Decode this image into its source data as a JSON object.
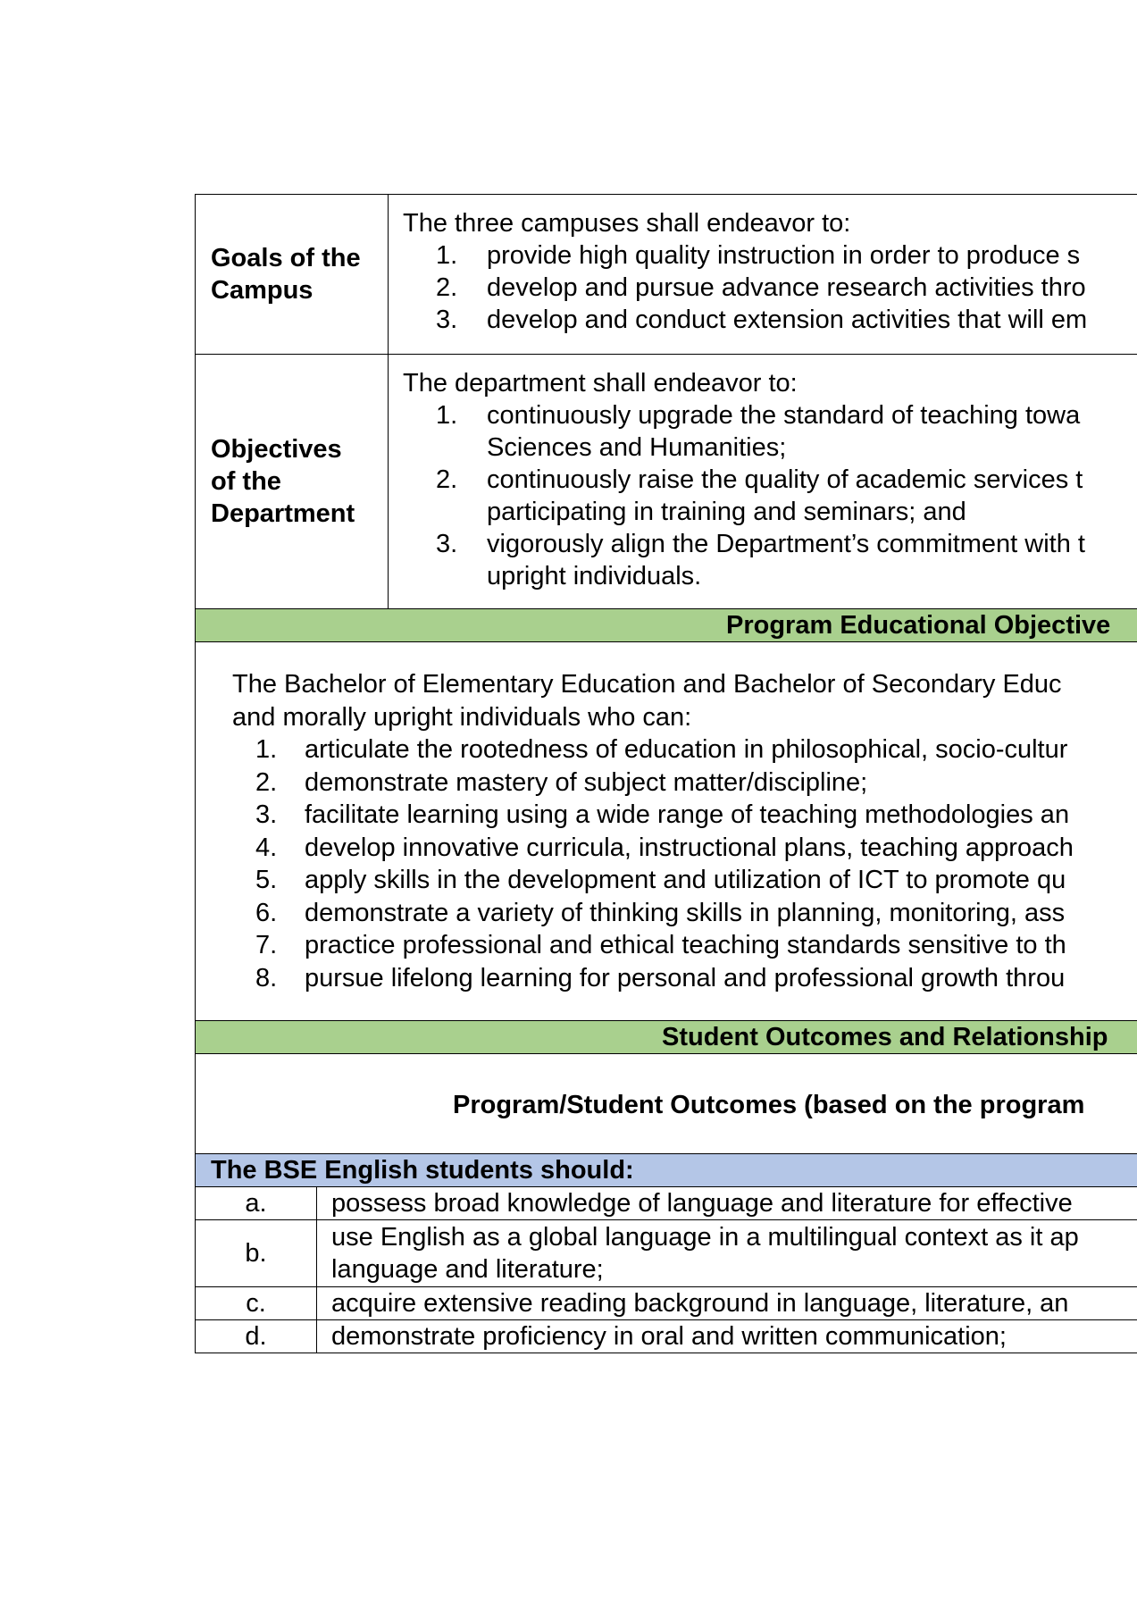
{
  "goals": {
    "label": "Goals of the Campus",
    "intro": "The three campuses shall endeavor to:",
    "items": [
      {
        "n": "1.",
        "text": "provide high quality instruction in order to produce s"
      },
      {
        "n": "2.",
        "text": "develop and pursue advance research activities thro"
      },
      {
        "n": "3.",
        "text": "develop and conduct extension activities that will em"
      }
    ]
  },
  "objectives": {
    "label": "Objectives of the Department",
    "intro": "The department shall endeavor to:",
    "items": [
      {
        "n": "1.",
        "line1": "continuously upgrade the standard of teaching towa",
        "line2": "Sciences and Humanities;"
      },
      {
        "n": "2.",
        "line1": "continuously raise the quality of academic services t",
        "line2": "participating in training and seminars; and"
      },
      {
        "n": "3.",
        "line1": "vigorously align the Department’s commitment with t",
        "line2": "upright individuals."
      }
    ]
  },
  "peo": {
    "banner": "Program Educational Objective",
    "intro_line1": "The Bachelor of Elementary Education and Bachelor of Secondary Educ",
    "intro_line2": "and morally upright individuals who can:",
    "items": [
      {
        "n": "1.",
        "text": "articulate the rootedness of education in philosophical, socio-cultur"
      },
      {
        "n": "2.",
        "text": "demonstrate mastery of subject matter/discipline;"
      },
      {
        "n": "3.",
        "text": "facilitate learning using a wide range of teaching methodologies an"
      },
      {
        "n": "4.",
        "text": "develop innovative curricula, instructional plans, teaching approach"
      },
      {
        "n": "5.",
        "text": "apply skills in the development and utilization of ICT to promote qu"
      },
      {
        "n": "6.",
        "text": "demonstrate a variety of thinking skills in planning, monitoring, ass"
      },
      {
        "n": "7.",
        "text": "practice professional and ethical teaching standards sensitive to th"
      },
      {
        "n": "8.",
        "text": "pursue lifelong learning for personal and professional growth throu"
      }
    ]
  },
  "student_outcomes": {
    "banner": "Student Outcomes and Relationship",
    "heading": "Program/Student Outcomes (based on the program",
    "students_bar": "The BSE English students should:",
    "items": [
      {
        "letter": "a.",
        "line1": "possess broad knowledge of language and literature for effective",
        "line2": ""
      },
      {
        "letter": "b.",
        "line1": "use English as a global language in a multilingual context as it ap",
        "line2": "language and literature;"
      },
      {
        "letter": "c.",
        "line1": "acquire extensive reading background in language, literature, an",
        "line2": ""
      },
      {
        "letter": "d.",
        "line1": "demonstrate proficiency in oral and written communication;",
        "line2": ""
      }
    ]
  },
  "colors": {
    "green_banner": "#a9d08e",
    "blue_bar": "#b4c6e7"
  }
}
